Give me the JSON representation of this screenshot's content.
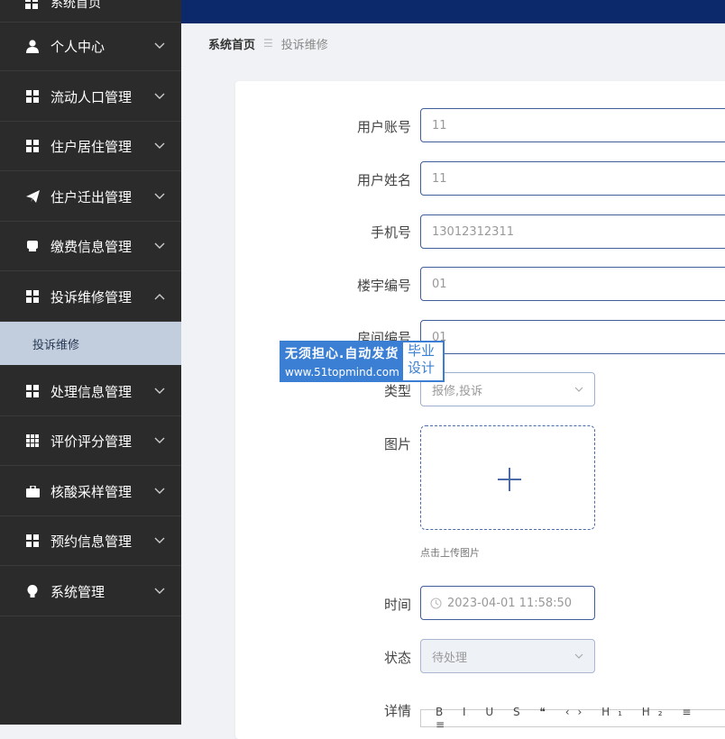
{
  "sidebar": {
    "top_label": "系统首页",
    "items": [
      {
        "label": "个人中心",
        "icon": "user-icon"
      },
      {
        "label": "流动人口管理",
        "icon": "grid-icon"
      },
      {
        "label": "住户居住管理",
        "icon": "grid-icon"
      },
      {
        "label": "住户迁出管理",
        "icon": "paper-plane-icon"
      },
      {
        "label": "缴费信息管理",
        "icon": "box-icon"
      },
      {
        "label": "投诉维修管理",
        "icon": "grid-icon"
      },
      {
        "label": "处理信息管理",
        "icon": "grid-icon"
      },
      {
        "label": "评价评分管理",
        "icon": "table-icon"
      },
      {
        "label": "核酸采样管理",
        "icon": "briefcase-icon"
      },
      {
        "label": "预约信息管理",
        "icon": "grid-icon"
      },
      {
        "label": "系统管理",
        "icon": "lightbulb-icon"
      }
    ],
    "active_submenu": "投诉维修"
  },
  "breadcrumb": {
    "home": "系统首页",
    "separator": "☰",
    "current": "投诉维修"
  },
  "form": {
    "account_label": "用户账号",
    "account_value": "11",
    "name_label": "用户姓名",
    "name_value": "11",
    "phone_label": "手机号",
    "phone_value": "13012312311",
    "building_label": "楼宇编号",
    "building_value": "01",
    "room_label": "房间编号",
    "room_value": "01",
    "type_label": "类型",
    "type_value": "报修,投诉",
    "image_label": "图片",
    "upload_hint": "点击上传图片",
    "time_label": "时间",
    "time_value": "2023-04-01 11:58:50",
    "status_label": "状态",
    "status_value": "待处理",
    "detail_label": "详情",
    "editor_toolbar": "B I U S ❝ ‹› H₁ H₂ ≡ ≡"
  },
  "watermark": {
    "line1": "无须担心.自动发货",
    "line2": "www.51topmind.com",
    "badge_top": "毕业",
    "badge_bottom": "设计"
  },
  "colors": {
    "sidebar_bg": "#2b2b2b",
    "topbar_bg": "#0c2a6b",
    "accent": "#3f5e9a",
    "submenu_active_bg": "#c2cede"
  }
}
